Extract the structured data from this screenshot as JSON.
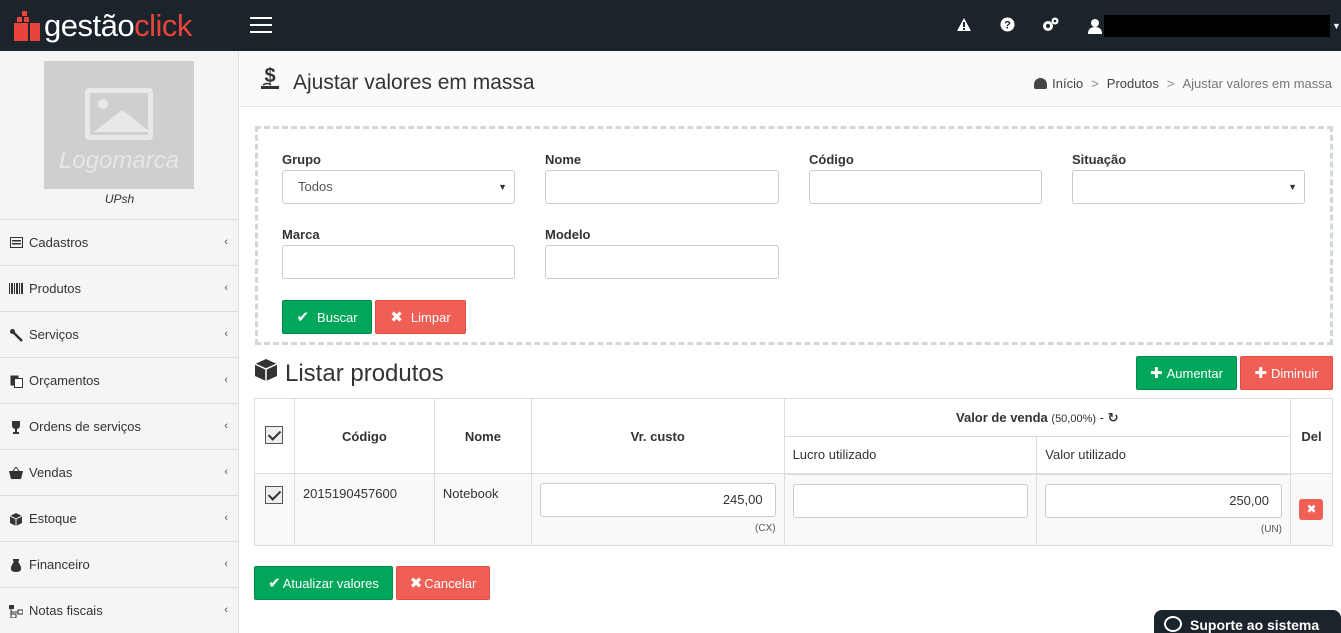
{
  "app": {
    "brand_part1": "gestão",
    "brand_part2": "click"
  },
  "topbar": {
    "icons": [
      "warning-icon",
      "help-icon",
      "settings-icon",
      "user-icon"
    ]
  },
  "sidebar": {
    "logo_caption": "Logomarca",
    "org_name": "UPsh",
    "items": [
      {
        "label": "Cadastros",
        "icon": "list-icon"
      },
      {
        "label": "Produtos",
        "icon": "barcode-icon"
      },
      {
        "label": "Serviços",
        "icon": "wrench-icon"
      },
      {
        "label": "Orçamentos",
        "icon": "copy-icon"
      },
      {
        "label": "Ordens de serviços",
        "icon": "trophy-icon"
      },
      {
        "label": "Vendas",
        "icon": "basket-icon"
      },
      {
        "label": "Estoque",
        "icon": "cube-icon"
      },
      {
        "label": "Financeiro",
        "icon": "money-bag-icon"
      },
      {
        "label": "Notas fiscais",
        "icon": "sitemap-icon"
      }
    ]
  },
  "page": {
    "title": "Ajustar valores em massa",
    "breadcrumb": [
      "Início",
      ">",
      "Produtos",
      ">",
      "Ajustar valores em massa"
    ]
  },
  "filters": {
    "grupo_label": "Grupo",
    "grupo_value": "Todos",
    "nome_label": "Nome",
    "codigo_label": "Código",
    "situacao_label": "Situação",
    "marca_label": "Marca",
    "modelo_label": "Modelo",
    "search_button": "Buscar",
    "clear_button": "Limpar"
  },
  "list": {
    "title": "Listar produtos",
    "increase_button": "Aumentar",
    "decrease_button": "Diminuir",
    "columns": {
      "codigo": "Código",
      "nome": "Nome",
      "custo": "Vr. custo",
      "valor_venda": "Valor de venda",
      "valor_venda_pct": "(50,00%)",
      "valor_venda_dash": "-",
      "lucro": "Lucro utilizado",
      "valor_utilizado": "Valor utilizado",
      "del": "Del"
    },
    "rows": [
      {
        "codigo": "2015190457600",
        "nome": "Notebook",
        "custo": "245,00",
        "custo_unit": "(CX)",
        "lucro": "",
        "valor": "250,00",
        "valor_unit": "(UN)"
      }
    ]
  },
  "actions": {
    "update_button": "Atualizar valores",
    "cancel_button": "Cancelar"
  },
  "support": {
    "label": "Suporte ao sistema"
  },
  "colors": {
    "topbar": "#1b232b",
    "brand_red": "#e8443b",
    "success": "#00a65a",
    "danger": "#f05f56"
  }
}
